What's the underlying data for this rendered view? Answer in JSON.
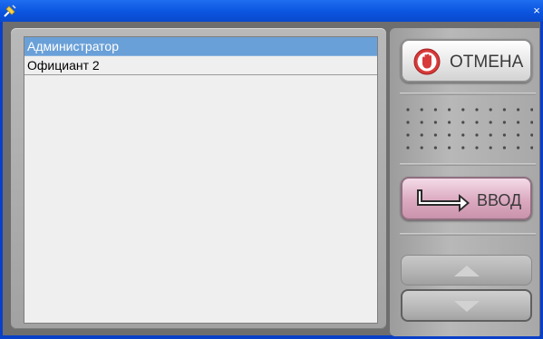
{
  "window": {
    "close_glyph": "×"
  },
  "list": {
    "items": [
      {
        "label": "Администратор",
        "selected": true
      },
      {
        "label": "Официант 2",
        "selected": false
      }
    ]
  },
  "buttons": {
    "cancel_label": "ОТМЕНА",
    "enter_label": "ВВОД",
    "cancel_icon": "stop-hand-icon",
    "enter_icon": "enter-arrow-icon",
    "up_icon": "triangle-up-icon",
    "down_icon": "triangle-down-icon"
  },
  "colors": {
    "titlebar": "#0b55df",
    "selection": "#6aa0d8",
    "cancel_icon_red": "#d83a3a",
    "enter_button": "#dba9c0"
  }
}
